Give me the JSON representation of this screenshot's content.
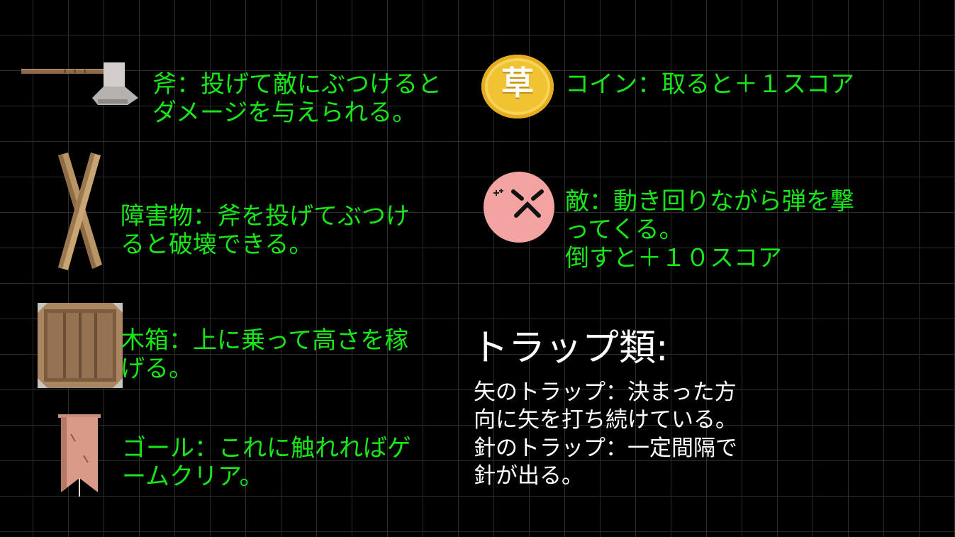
{
  "items": {
    "axe": {
      "icon": "axe-icon",
      "text": "斧：投げて敵にぶつけると\nダメージを与えられる。"
    },
    "obstacle": {
      "icon": "crossed-sticks-icon",
      "text": "障害物：斧を投げてぶつけ\nると破壊できる。"
    },
    "crate": {
      "icon": "wooden-crate-icon",
      "text": "木箱：上に乗って高さを稼\nげる。"
    },
    "goal": {
      "icon": "banner-flag-icon",
      "text": "ゴール：これに触れればゲ\nームクリア。"
    },
    "coin": {
      "icon": "gold-coin-icon",
      "glyph": "草",
      "text": "コイン：取ると＋１スコア"
    },
    "enemy": {
      "icon": "angry-face-enemy-icon",
      "text": "敵：動き回りながら弾を撃\nってくる。\n倒すと＋１０スコア"
    }
  },
  "traps": {
    "heading": "トラップ類:",
    "text": "矢のトラップ：決まった方\n向に矢を打ち続けている。\n針のトラップ：一定間隔で\n針が出る。"
  },
  "colors": {
    "description_text": "#19e619",
    "trap_text": "#ffffff",
    "background": "#000000",
    "grid": "#2c2c2c",
    "coin": "#f1c232",
    "enemy": "#f4a3a3",
    "wood": "#9b7a50",
    "banner": "#d99a88"
  }
}
